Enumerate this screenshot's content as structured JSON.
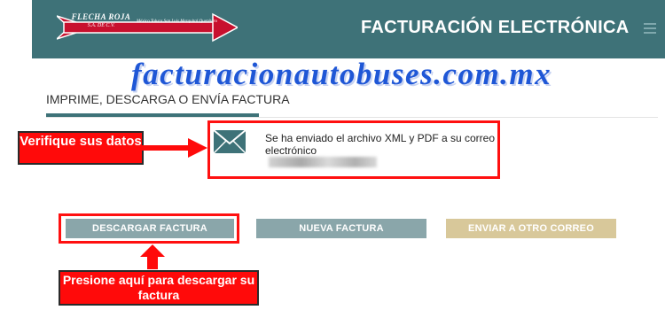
{
  "header": {
    "brand": "FLECHA ROJA",
    "brand_sub": "S.A. DE C.V.",
    "route": "México Toluca San Luis Mezquital Querétaro",
    "title": "FACTURACIÓN ELECTRÓNICA",
    "menu_icon": "hamburger-menu-icon",
    "background_color": "#3e7278"
  },
  "watermark": "facturacionautobuses.com.mx",
  "section": {
    "heading": "IMPRIME, DESCARGA O ENVÍA FACTURA"
  },
  "notice": {
    "icon": "envelope-icon",
    "message": "Se ha enviado el archivo XML y PDF a su correo electrónico"
  },
  "callouts": {
    "verify": "Verifique sus datos",
    "download": "Presione aquí para descargar su factura",
    "color": "#ff0a0a"
  },
  "buttons": {
    "download": "DESCARGAR FACTURA",
    "new": "NUEVA FACTURA",
    "resend": "ENVIAR A OTRO CORREO",
    "primary_color": "#8aa6aa",
    "secondary_color": "#d8c89a"
  }
}
